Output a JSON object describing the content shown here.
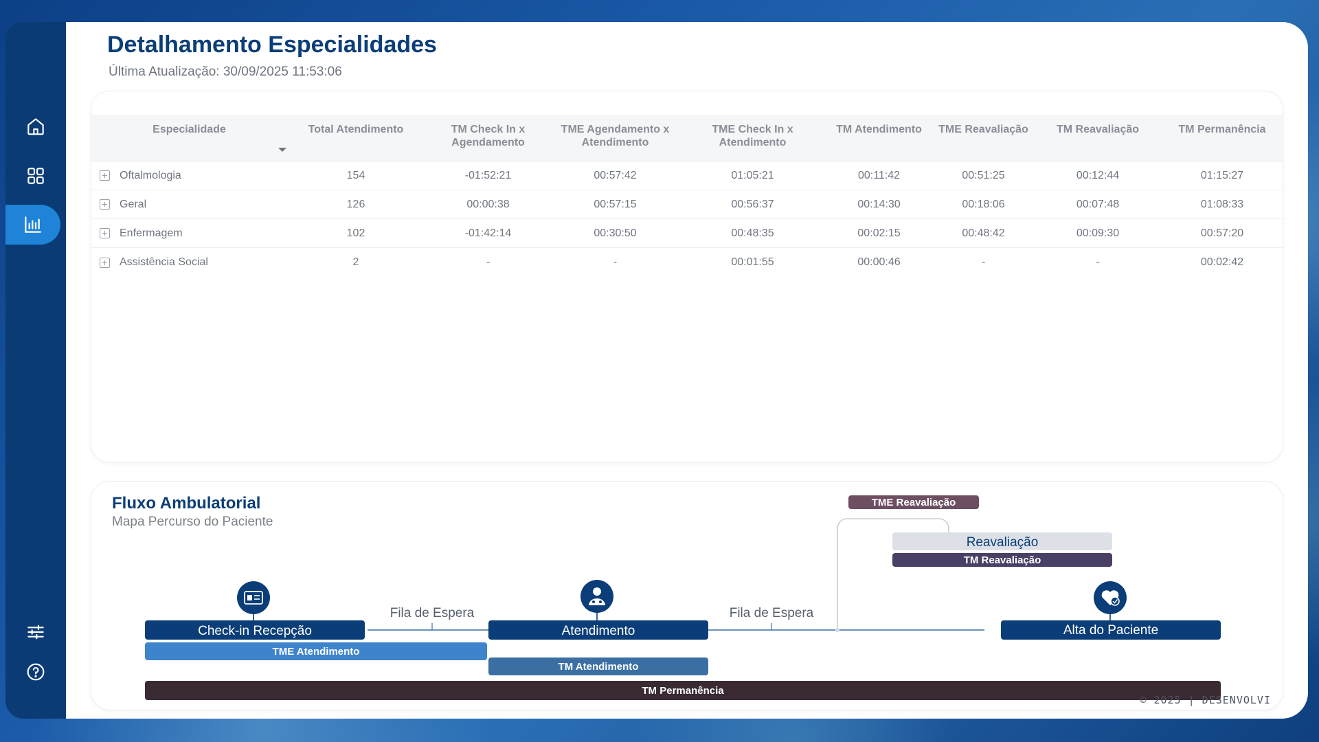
{
  "page": {
    "title": "Detalhamento Especialidades",
    "last_update": "Última Atualização: 30/09/2025 11:53:06"
  },
  "sidebar": {
    "items": [
      {
        "icon": "home-icon"
      },
      {
        "icon": "grid-icon"
      },
      {
        "icon": "bar-chart-icon",
        "active": true
      },
      {
        "icon": "sliders-icon"
      },
      {
        "icon": "help-icon"
      }
    ],
    "active_color": "#1f84d8",
    "bg_color": "#0a3b75"
  },
  "table": {
    "columns": [
      "Especialidade",
      "Total Atendimento",
      "TM Check In x\nAgendamento",
      "TME Agendamento x\nAtendimento",
      "TME Check In x\nAtendimento",
      "TM Atendimento",
      "TME Reavaliação",
      "TM Reavaliação",
      "TM Permanência"
    ],
    "rows": [
      [
        "Oftalmologia",
        "154",
        "-01:52:21",
        "00:57:42",
        "01:05:21",
        "00:11:42",
        "00:51:25",
        "00:12:44",
        "01:15:27"
      ],
      [
        "Geral",
        "126",
        "00:00:38",
        "00:57:15",
        "00:56:37",
        "00:14:30",
        "00:18:06",
        "00:07:48",
        "01:08:33"
      ],
      [
        "Enfermagem",
        "102",
        "-01:42:14",
        "00:30:50",
        "00:48:35",
        "00:02:15",
        "00:48:42",
        "00:09:30",
        "00:57:20"
      ],
      [
        "Assistência Social",
        "2",
        "-",
        "-",
        "00:01:55",
        "00:00:46",
        "-",
        "-",
        "00:02:42"
      ]
    ]
  },
  "flow": {
    "title": "Fluxo Ambulatorial",
    "subtitle": "Mapa Percurso do Paciente",
    "checkin_label": "Check-in Recepção",
    "queue1_label": "Fila de Espera",
    "atendimento_label": "Atendimento",
    "queue2_label": "Fila de Espera",
    "alta_label": "Alta do Paciente",
    "reavaliacao_label": "Reavaliação",
    "tme_reavaliacao_label": "TME Reavaliação",
    "tm_reavaliacao_label": "TM Reavaliação",
    "tme_atendimento_label": "TME Atendimento",
    "tm_atendimento_label": "TM Atendimento",
    "tm_permanencia_label": "TM Permanência",
    "colors": {
      "navy": "#0b3e78",
      "mid_blue": "#3d84cc",
      "steel_blue": "#3b6fa3",
      "dark": "#3a2a33",
      "mauve": "#6e4f62",
      "purple": "#4a3f64",
      "light_gray": "#dde1e7"
    }
  },
  "footer": {
    "copyright": "© 2025 | DESENVOLVI"
  }
}
